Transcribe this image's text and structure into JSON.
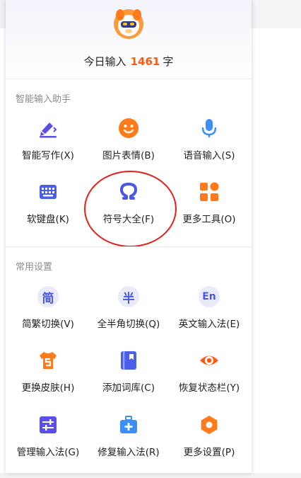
{
  "header": {
    "today_prefix": "今日输入",
    "today_count": "1461",
    "today_suffix": "字"
  },
  "sections": {
    "assistant_title": "智能输入助手",
    "common_title": "常用设置"
  },
  "tools": {
    "smart_write": "智能写作(X)",
    "image_emoji": "图片表情(B)",
    "voice_input": "语音输入(S)",
    "soft_keyboard": "软键盘(K)",
    "symbols": "符号大全(F)",
    "more_tools": "更多工具(O)",
    "simp_trad": "简繁切换(V)",
    "full_half": "全半角切换(Q)",
    "english_method": "英文输入法(E)",
    "change_skin": "更换皮肤(H)",
    "add_lexicon": "添加词库(C)",
    "restore_statusbar": "恢复状态栏(Y)",
    "manage_methods": "管理输入法(G)",
    "repair_method": "修复输入法(R)",
    "more_settings": "更多设置(P)"
  },
  "icon_text": {
    "simp": "简",
    "half": "半",
    "en": "En"
  },
  "colors": {
    "accent_orange": "#ff5a12",
    "accent_blue": "#4a57e0",
    "highlight_ring": "#e3201b"
  },
  "icons": [
    "avatar-mascot",
    "pen-icon",
    "smile-icon",
    "microphone-icon",
    "keyboard-icon",
    "omega-icon",
    "apps-icon",
    "simplified-icon",
    "half-width-icon",
    "english-icon",
    "shirt-icon",
    "book-icon",
    "eye-icon",
    "sliders-icon",
    "toolbox-icon",
    "hexagon-gear-icon"
  ]
}
